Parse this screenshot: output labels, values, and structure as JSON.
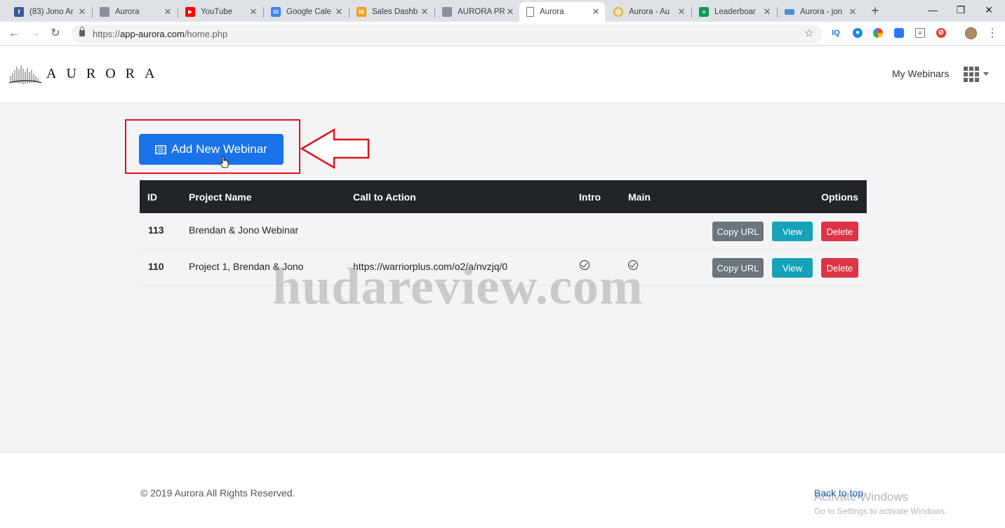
{
  "browser": {
    "tabs": [
      {
        "label": "(83) Jono Ar",
        "icon": "facebook-icon",
        "color": "#3b5998",
        "glyph": "f"
      },
      {
        "label": "Aurora",
        "icon": "aurora-icon",
        "color": "#8a8f98",
        "glyph": ""
      },
      {
        "label": "YouTube",
        "icon": "youtube-icon",
        "color": "#ff0000",
        "glyph": "▶"
      },
      {
        "label": "Google Cale",
        "icon": "calendar-icon",
        "color": "#4285f4",
        "glyph": "22"
      },
      {
        "label": "Sales Dashb",
        "icon": "warriorplus-icon",
        "color": "#f39c12",
        "glyph": "W"
      },
      {
        "label": "AURORA PR",
        "icon": "aurora-icon",
        "color": "#8a8f98",
        "glyph": ""
      },
      {
        "label": "Aurora",
        "icon": "page-icon",
        "color": "#ffffff",
        "glyph": "",
        "active": true
      },
      {
        "label": "Aurora - Au",
        "icon": "loading-icon",
        "color": "#f4b400",
        "glyph": ""
      },
      {
        "label": "Leaderboar",
        "icon": "sheets-icon",
        "color": "#0f9d58",
        "glyph": "+"
      },
      {
        "label": "Aurora - jon",
        "icon": "mail-icon",
        "color": "#4a90d9",
        "glyph": ""
      }
    ],
    "url_prefix": "https://",
    "url_host": "app-aurora.com",
    "url_path": "/home.php"
  },
  "header": {
    "logo_text": "AURORA",
    "menu_label": "My Webinars"
  },
  "actions": {
    "add_label": "Add New Webinar"
  },
  "table": {
    "columns": {
      "id": "ID",
      "name": "Project Name",
      "cta": "Call to Action",
      "intro": "Intro",
      "main": "Main",
      "options": "Options"
    },
    "rows": [
      {
        "id": "113",
        "name": "Brendan & Jono Webinar",
        "cta": "",
        "intro": false,
        "main": false
      },
      {
        "id": "110",
        "name": "Project 1, Brendan & Jono",
        "cta": "https://warriorplus.com/o2/a/nvzjq/0",
        "intro": true,
        "main": true
      }
    ],
    "buttons": {
      "copy": "Copy URL",
      "view": "View",
      "delete": "Delete"
    }
  },
  "watermark": "hudareview.com",
  "footer": {
    "copyright": "© 2019 Aurora All Rights Reserved.",
    "back_to_top": "Back to top",
    "activate_title": "Activate Windows",
    "activate_sub": "Go to Settings to activate Windows."
  },
  "colors": {
    "primary": "#1a73e8",
    "annotation": "#e0131d",
    "copy": "#6c757d",
    "view": "#17a2b8",
    "delete": "#dc3545"
  }
}
